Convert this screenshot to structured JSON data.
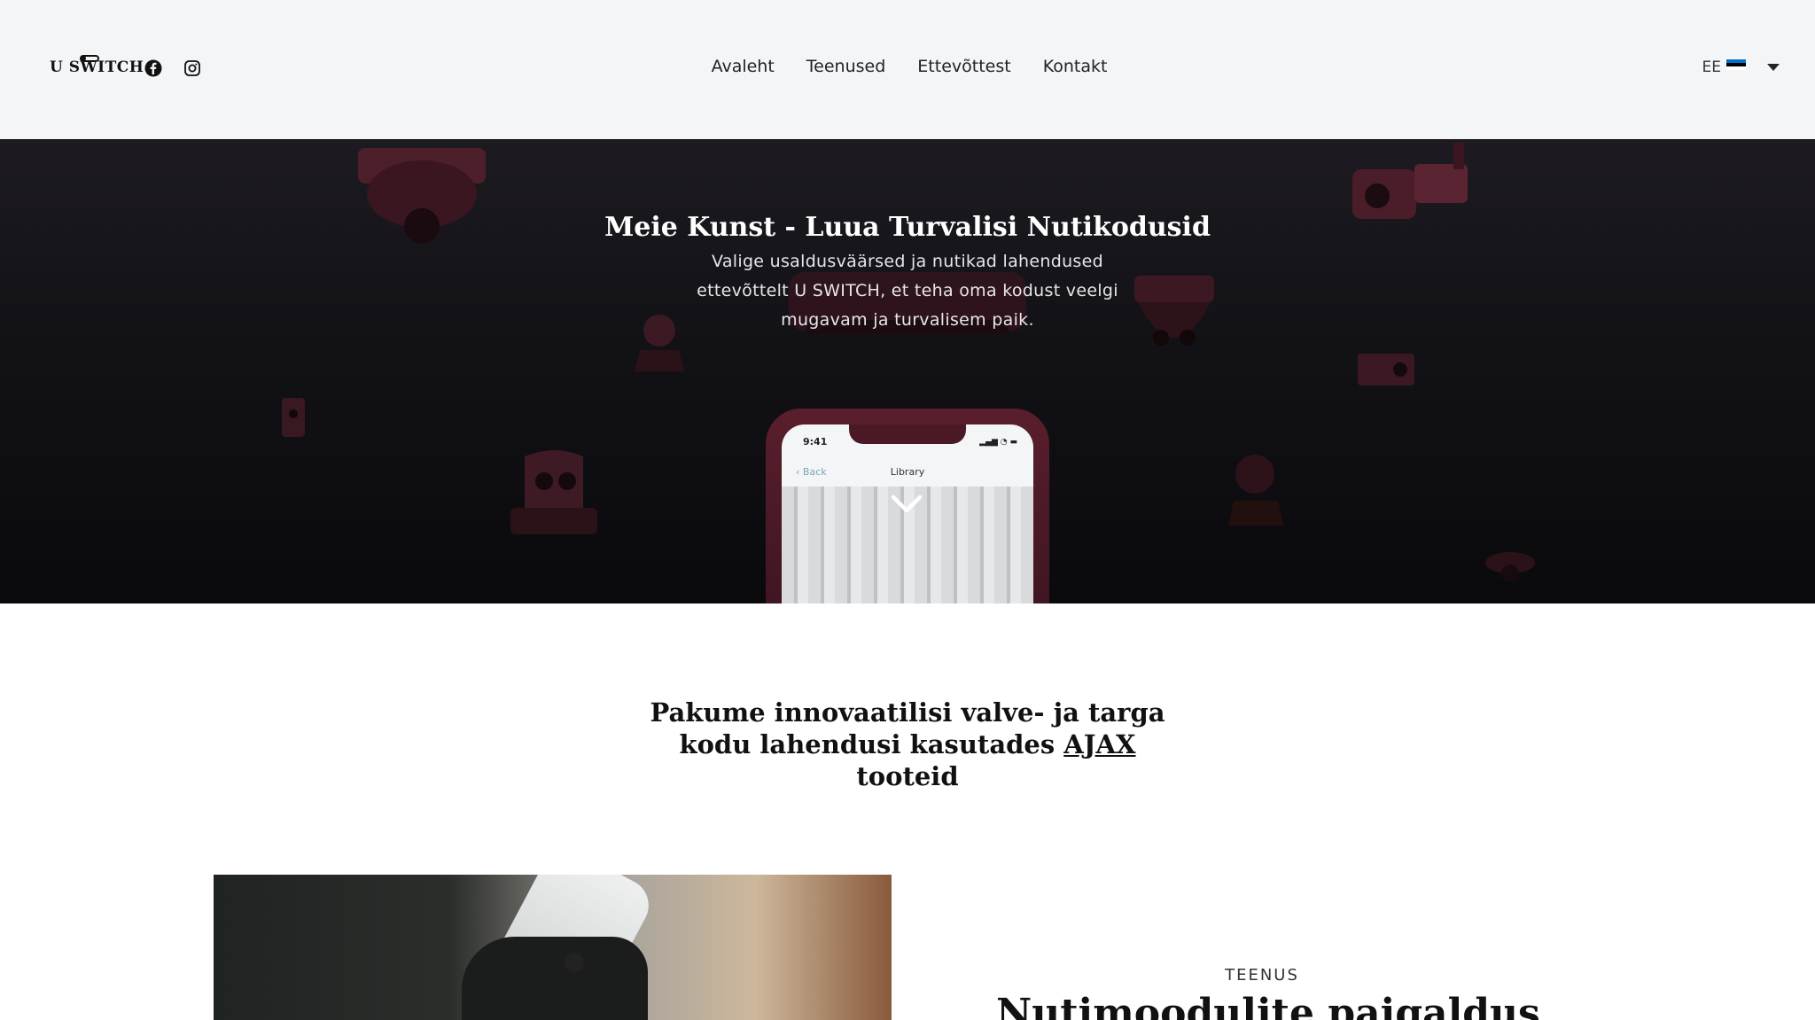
{
  "header": {
    "logo_text": "U SWITCH",
    "nav": [
      "Avaleht",
      "Teenused",
      "Ettevõttest",
      "Kontakt"
    ],
    "language": {
      "code": "EE",
      "flag_colors": [
        "#0072ce",
        "#000000",
        "#ffffff"
      ]
    }
  },
  "hero": {
    "title": "Meie Kunst - Luua Turvalisi Nutikodusid",
    "subtitle": "Valige usaldusväärsed ja nutikad lahendused ettevõttelt U SWITCH, et teha oma kodust veelgi mugavam ja turvalisem paik.",
    "phone": {
      "time": "9:41",
      "back": "Back",
      "screen_title": "Library"
    }
  },
  "intro": {
    "text_before": "Pakume innovaatilisi valve- ja targa kodu lahendusi kasutades ",
    "link": "AJAX",
    "text_after": " tooteid"
  },
  "service": {
    "tag": "TEENUS",
    "title": "Nutimoodulite paigaldus"
  },
  "colors": {
    "header_bg": "#f3f5f7",
    "hero_accent": "#5a1e2c",
    "text": "#111111"
  },
  "icons": [
    "facebook-icon",
    "instagram-icon",
    "chevron-down-icon",
    "caret-down-icon"
  ]
}
